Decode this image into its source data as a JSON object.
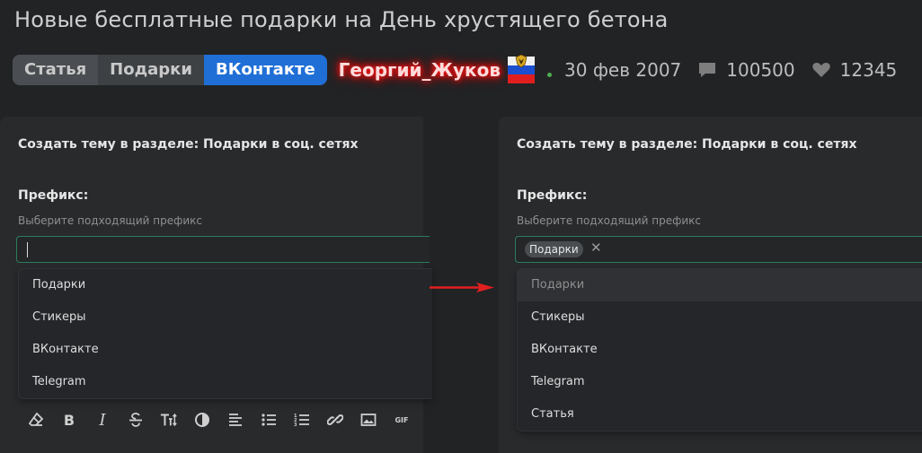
{
  "page_title": "Новые бесплатные подарки на День хрустящего бетона",
  "header": {
    "tabs": [
      {
        "label": "Статья"
      },
      {
        "label": "Подарки"
      },
      {
        "label": "ВКонтакте"
      }
    ],
    "author": "Георгий_Жуков",
    "date": "30 фев 2007",
    "comments": "100500",
    "likes": "12345",
    "colors": {
      "active_tab": "#1f6fd6",
      "author_glow": "#ff0000",
      "online_dot": "#4caf50"
    }
  },
  "left_panel": {
    "title": "Создать тему в разделе: Подарки в соц. сетях",
    "prefix_label": "Префикс:",
    "prefix_hint": "Выберите подходящий префикс",
    "options": [
      "Подарки",
      "Стикеры",
      "ВКонтакте",
      "Telegram"
    ],
    "toolbar": [
      "eraser-icon",
      "bold-icon",
      "italic-icon",
      "strikethrough-icon",
      "text-size-icon",
      "color-icon",
      "align-icon",
      "bulleted-list-icon",
      "numbered-list-icon",
      "link-icon",
      "image-icon",
      "gif-icon"
    ],
    "bold_glyph": "B",
    "italic_glyph": "I",
    "gif_label": "GIF"
  },
  "right_panel": {
    "title": "Создать тему в разделе: Подарки в соц. сетях",
    "prefix_label": "Префикс:",
    "prefix_hint": "Выберите подходящий префикс",
    "selected_chip": "Подарки",
    "chip_remove": "✕",
    "options": [
      "Подарки",
      "Стикеры",
      "ВКонтакте",
      "Telegram",
      "Статья"
    ],
    "disabled_option": "Подарки"
  }
}
